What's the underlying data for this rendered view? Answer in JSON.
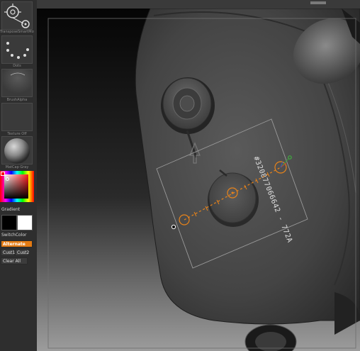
{
  "tray": {
    "brush_label": "TransposeSmartMove",
    "stroke_label": "Dots",
    "alpha_label": "BrushAlpha",
    "texture_label": "Texture Off",
    "material_label": "MatCap Gray",
    "gradient_label": "Gradient",
    "switch_color_label": "SwitchColor",
    "alternate_label": "Alternate",
    "cust1_label": "Cust1",
    "cust2_label": "Cust2",
    "clear_all_label": "Clear All",
    "colors": {
      "main_color": "#000000",
      "secondary_color": "#ffffff",
      "alternate_accent": "#e37a12"
    }
  },
  "viewport": {
    "engraved_text": "#320877066642 - 772A",
    "transpose_line_color": "#e8831a",
    "icons": [
      "transpose-circle-start-icon",
      "transpose-circle-middle-icon",
      "transpose-circle-end-icon",
      "gizmo-axis-icon",
      "cursor-dot-icon"
    ]
  }
}
